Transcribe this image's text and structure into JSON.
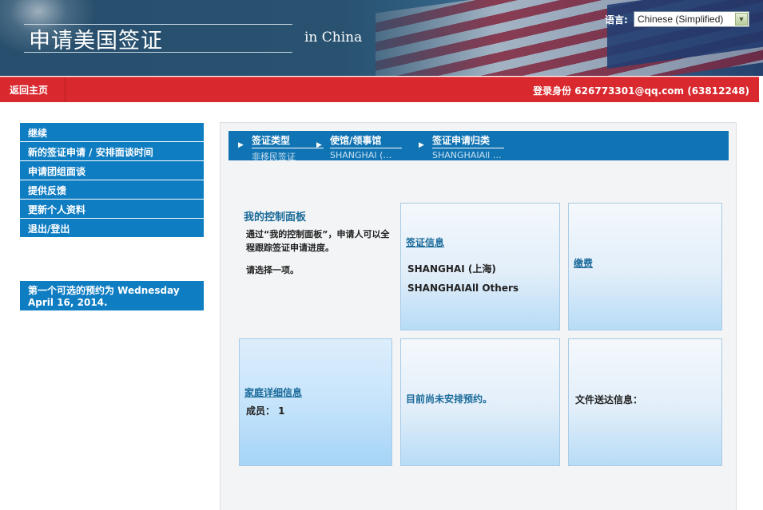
{
  "header": {
    "title": "申请美国签证",
    "subtitle": "in China",
    "language_label": "语言:",
    "language_selected": "Chinese (Simplified)"
  },
  "navbar": {
    "home_label": "返回主页",
    "login_text": "登录身份  626773301@qq.com (63812248)"
  },
  "sidebar": {
    "items": [
      {
        "label": "继续"
      },
      {
        "label": "新的签证申请 / 安排面谈时间"
      },
      {
        "label": "申请团组面谈"
      },
      {
        "label": "提供反馈"
      },
      {
        "label": "更新个人资料"
      },
      {
        "label": "退出/登出"
      }
    ],
    "notice": "第一个可选的预约为 Wednesday April 16, 2014."
  },
  "breadcrumbs": [
    {
      "label": "签证类型",
      "value": "非移民签证"
    },
    {
      "label": "使馆/领事馆",
      "value": "SHANGHAI (…"
    },
    {
      "label": "签证申请归类",
      "value": "SHANGHAIAll …"
    }
  ],
  "dashboard": {
    "title": "我的控制面板",
    "description": "通过“我的控制面板”，申请人可以全程跟踪签证申请进度。",
    "prompt": "请选择一项。"
  },
  "cards": {
    "visa_info": {
      "link": "签证信息",
      "lines": [
        "SHANGHAI (上海)",
        "SHANGHAIAll Others"
      ]
    },
    "payment": {
      "link": "缴费"
    },
    "family": {
      "link": "家庭详细信息",
      "members": "成员： 1"
    },
    "appointment": {
      "text": "目前尚未安排预约。"
    },
    "delivery": {
      "text": "文件送达信息："
    }
  }
}
